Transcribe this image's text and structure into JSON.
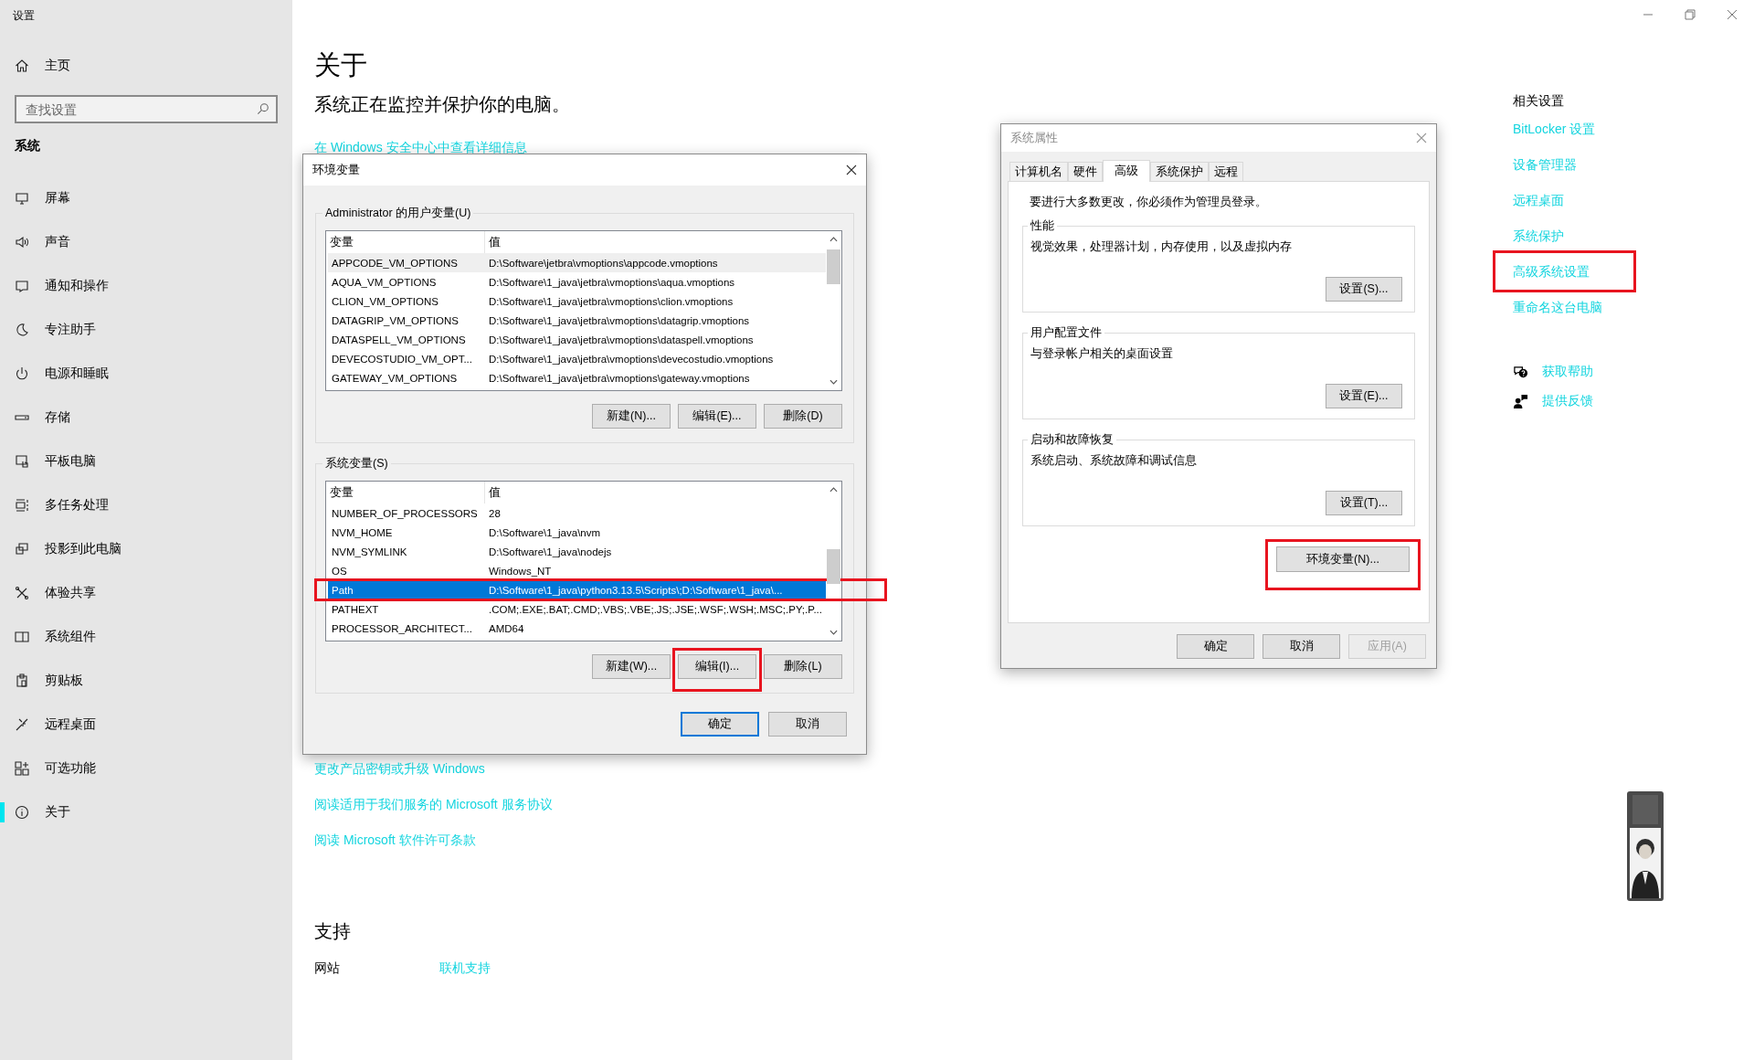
{
  "window": {
    "title": "设置"
  },
  "sidebar": {
    "home": "主页",
    "search": {
      "placeholder": "查找设置"
    },
    "section": "系统",
    "items": [
      {
        "kind": "display",
        "label": "屏幕",
        "selected": false
      },
      {
        "kind": "sound",
        "label": "声音",
        "selected": false
      },
      {
        "kind": "notification",
        "label": "通知和操作",
        "selected": false
      },
      {
        "kind": "focus",
        "label": "专注助手",
        "selected": false
      },
      {
        "kind": "power",
        "label": "电源和睡眠",
        "selected": false
      },
      {
        "kind": "storage",
        "label": "存储",
        "selected": false
      },
      {
        "kind": "tablet",
        "label": "平板电脑",
        "selected": false
      },
      {
        "kind": "multitask",
        "label": "多任务处理",
        "selected": false
      },
      {
        "kind": "project",
        "label": "投影到此电脑",
        "selected": false
      },
      {
        "kind": "share",
        "label": "体验共享",
        "selected": false
      },
      {
        "kind": "components",
        "label": "系统组件",
        "selected": false
      },
      {
        "kind": "clipboard",
        "label": "剪贴板",
        "selected": false
      },
      {
        "kind": "remote",
        "label": "远程桌面",
        "selected": false
      },
      {
        "kind": "optional",
        "label": "可选功能",
        "selected": false
      },
      {
        "kind": "about",
        "label": "关于",
        "selected": true
      }
    ]
  },
  "main": {
    "heading": "关于",
    "status": "系统正在监控并保护你的电脑。",
    "security_link": "在 Windows 安全中心中查看详细信息",
    "links": [
      "更改产品密钥或升级 Windows",
      "阅读适用于我们服务的 Microsoft 服务协议",
      "阅读 Microsoft 软件许可条款"
    ],
    "support": {
      "heading": "支持",
      "rows": [
        {
          "label": "网站",
          "link": "联机支持"
        }
      ]
    }
  },
  "related": {
    "heading": "相关设置",
    "links": [
      {
        "label": "BitLocker 设置",
        "highlighted": false
      },
      {
        "label": "设备管理器",
        "highlighted": false
      },
      {
        "label": "远程桌面",
        "highlighted": false
      },
      {
        "label": "系统保护",
        "highlighted": false
      },
      {
        "label": "高级系统设置",
        "highlighted": true
      },
      {
        "label": "重命名这台电脑",
        "highlighted": false
      }
    ],
    "help": [
      {
        "kind": "help",
        "label": "获取帮助"
      },
      {
        "kind": "feedback",
        "label": "提供反馈"
      }
    ]
  },
  "env_dialog": {
    "title": "环境变量",
    "active": true,
    "groups": [
      {
        "label": "Administrator 的用户变量(U)",
        "focused": false,
        "columns": [
          "变量",
          "值"
        ],
        "rows": [
          {
            "name": "APPCODE_VM_OPTIONS",
            "value": "D:\\Software\\jetbra\\vmoptions\\appcode.vmoptions",
            "selected": true,
            "highlighted": false
          },
          {
            "name": "AQUA_VM_OPTIONS",
            "value": "D:\\Software\\1_java\\jetbra\\vmoptions\\aqua.vmoptions",
            "selected": false,
            "highlighted": false
          },
          {
            "name": "CLION_VM_OPTIONS",
            "value": "D:\\Software\\1_java\\jetbra\\vmoptions\\clion.vmoptions",
            "selected": false,
            "highlighted": false
          },
          {
            "name": "DATAGRIP_VM_OPTIONS",
            "value": "D:\\Software\\1_java\\jetbra\\vmoptions\\datagrip.vmoptions",
            "selected": false,
            "highlighted": false
          },
          {
            "name": "DATASPELL_VM_OPTIONS",
            "value": "D:\\Software\\1_java\\jetbra\\vmoptions\\dataspell.vmoptions",
            "selected": false,
            "highlighted": false
          },
          {
            "name": "DEVECOSTUDIO_VM_OPT...",
            "value": "D:\\Software\\1_java\\jetbra\\vmoptions\\devecostudio.vmoptions",
            "selected": false,
            "highlighted": false
          },
          {
            "name": "GATEWAY_VM_OPTIONS",
            "value": "D:\\Software\\1_java\\jetbra\\vmoptions\\gateway.vmoptions",
            "selected": false,
            "highlighted": false
          }
        ],
        "buttons": [
          {
            "label": "新建(N)...",
            "highlighted": false
          },
          {
            "label": "编辑(E)...",
            "highlighted": false
          },
          {
            "label": "删除(D)",
            "highlighted": false
          }
        ]
      },
      {
        "label": "系统变量(S)",
        "focused": true,
        "columns": [
          "变量",
          "值"
        ],
        "rows": [
          {
            "name": "NUMBER_OF_PROCESSORS",
            "value": "28",
            "selected": false,
            "highlighted": false
          },
          {
            "name": "NVM_HOME",
            "value": "D:\\Software\\1_java\\nvm",
            "selected": false,
            "highlighted": false
          },
          {
            "name": "NVM_SYMLINK",
            "value": "D:\\Software\\1_java\\nodejs",
            "selected": false,
            "highlighted": false
          },
          {
            "name": "OS",
            "value": "Windows_NT",
            "selected": false,
            "highlighted": false
          },
          {
            "name": "Path",
            "value": "D:\\Software\\1_java\\python3.13.5\\Scripts\\;D:\\Software\\1_java\\...",
            "selected": true,
            "highlighted": true
          },
          {
            "name": "PATHEXT",
            "value": ".COM;.EXE;.BAT;.CMD;.VBS;.VBE;.JS;.JSE;.WSF;.WSH;.MSC;.PY;.P...",
            "selected": false,
            "highlighted": false
          },
          {
            "name": "PROCESSOR_ARCHITECT...",
            "value": "AMD64",
            "selected": false,
            "highlighted": false
          }
        ],
        "buttons": [
          {
            "label": "新建(W)...",
            "highlighted": false
          },
          {
            "label": "编辑(I)...",
            "highlighted": true
          },
          {
            "label": "删除(L)",
            "highlighted": false
          }
        ]
      }
    ],
    "buttons": [
      {
        "label": "确定",
        "default": true
      },
      {
        "label": "取消",
        "default": false
      }
    ]
  },
  "sys_dialog": {
    "title": "系统属性",
    "active": false,
    "tabs": [
      {
        "label": "计算机名",
        "selected": false
      },
      {
        "label": "硬件",
        "selected": false
      },
      {
        "label": "高级",
        "selected": true
      },
      {
        "label": "系统保护",
        "selected": false
      },
      {
        "label": "远程",
        "selected": false
      }
    ],
    "notice": "要进行大多数更改，你必须作为管理员登录。",
    "groups": [
      {
        "title": "性能",
        "text": "视觉效果，处理器计划，内存使用，以及虚拟内存",
        "button": "设置(S)..."
      },
      {
        "title": "用户配置文件",
        "text": "与登录帐户相关的桌面设置",
        "button": "设置(E)..."
      },
      {
        "title": "启动和故障恢复",
        "text": "系统启动、系统故障和调试信息",
        "button": "设置(T)..."
      }
    ],
    "env_button": {
      "label": "环境变量(N)...",
      "highlighted": true
    },
    "buttons": [
      {
        "label": "确定",
        "disabled": false
      },
      {
        "label": "取消",
        "disabled": false
      },
      {
        "label": "应用(A)",
        "disabled": true
      }
    ]
  }
}
